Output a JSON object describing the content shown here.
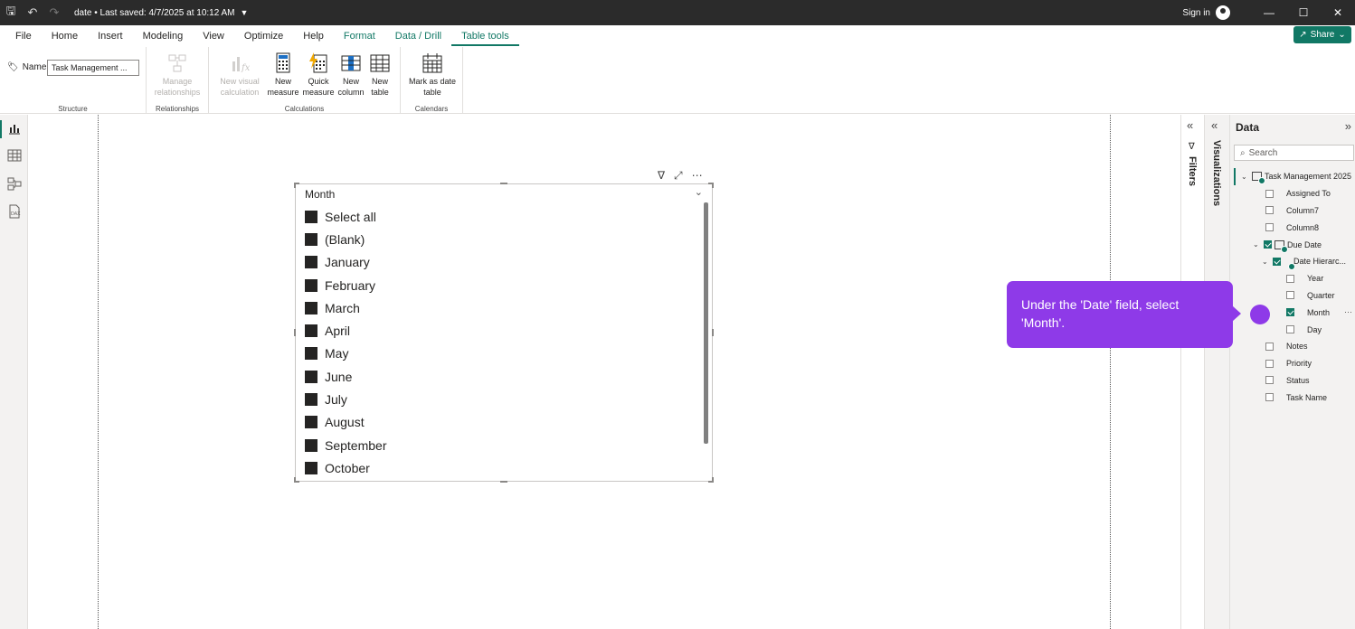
{
  "titlebar": {
    "title": "date • Last saved: 4/7/2025 at 10:12 AM",
    "sign_in": "Sign in"
  },
  "menu": {
    "items": [
      "File",
      "Home",
      "Insert",
      "Modeling",
      "View",
      "Optimize",
      "Help",
      "Format",
      "Data / Drill",
      "Table tools"
    ],
    "share": "Share"
  },
  "ribbon": {
    "structure": {
      "name_label": "Name",
      "name_value": "Task Management ...",
      "label": "Structure"
    },
    "relationships": {
      "manage_line1": "Manage",
      "manage_line2": "relationships",
      "label": "Relationships"
    },
    "calculations": {
      "new_visual_calc_line1": "New visual",
      "new_visual_calc_line2": "calculation",
      "new_measure_line1": "New",
      "new_measure_line2": "measure",
      "quick_measure_line1": "Quick",
      "quick_measure_line2": "measure",
      "new_column_line1": "New",
      "new_column_line2": "column",
      "new_table_line1": "New",
      "new_table_line2": "table",
      "label": "Calculations"
    },
    "calendars": {
      "mark_date_line1": "Mark as date",
      "mark_date_line2": "table",
      "label": "Calendars"
    }
  },
  "slicer": {
    "title": "Month",
    "items": [
      "Select all",
      "(Blank)",
      "January",
      "February",
      "March",
      "April",
      "May",
      "June",
      "July",
      "August",
      "September",
      "October"
    ]
  },
  "panes": {
    "filters": "Filters",
    "visualizations": "Visualizations",
    "data_title": "Data",
    "search_placeholder": "Search"
  },
  "data_tree": {
    "table": "Task Management 2025",
    "fields": {
      "assigned_to": "Assigned To",
      "column7": "Column7",
      "column8": "Column8",
      "due_date": "Due Date",
      "date_hierarchy": "Date Hierarc...",
      "year": "Year",
      "quarter": "Quarter",
      "month": "Month",
      "day": "Day",
      "notes": "Notes",
      "priority": "Priority",
      "status": "Status",
      "task_name": "Task Name"
    }
  },
  "tooltip": {
    "text": "Under the 'Date' field, select 'Month'."
  },
  "colors": {
    "accent": "#117865",
    "tooltip": "#8e3ae8",
    "titlebar": "#2b2b2b"
  }
}
